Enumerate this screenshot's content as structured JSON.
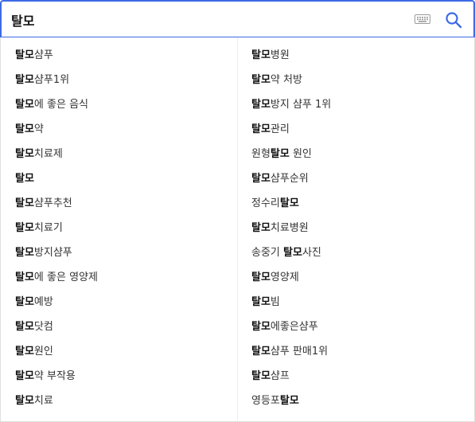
{
  "search": {
    "query": "탈모",
    "keyboard_icon": "keyboard-icon",
    "search_icon": "search-icon",
    "accent_color": "#3d6ae6"
  },
  "suggestions": {
    "left": [
      {
        "pre": "",
        "match": "탈모",
        "post": "샴푸"
      },
      {
        "pre": "",
        "match": "탈모",
        "post": "샴푸1위"
      },
      {
        "pre": "",
        "match": "탈모",
        "post": "에 좋은 음식"
      },
      {
        "pre": "",
        "match": "탈모",
        "post": "약"
      },
      {
        "pre": "",
        "match": "탈모",
        "post": "치료제"
      },
      {
        "pre": "",
        "match": "탈모",
        "post": ""
      },
      {
        "pre": "",
        "match": "탈모",
        "post": "샴푸추천"
      },
      {
        "pre": "",
        "match": "탈모",
        "post": "치료기"
      },
      {
        "pre": "",
        "match": "탈모",
        "post": "방지샴푸"
      },
      {
        "pre": "",
        "match": "탈모",
        "post": "에 좋은 영양제"
      },
      {
        "pre": "",
        "match": "탈모",
        "post": "예방"
      },
      {
        "pre": "",
        "match": "탈모",
        "post": "닷컴"
      },
      {
        "pre": "",
        "match": "탈모",
        "post": "원인"
      },
      {
        "pre": "",
        "match": "탈모",
        "post": "약 부작용"
      },
      {
        "pre": "",
        "match": "탈모",
        "post": "치료"
      }
    ],
    "right": [
      {
        "pre": "",
        "match": "탈모",
        "post": "병원"
      },
      {
        "pre": "",
        "match": "탈모",
        "post": "약 처방"
      },
      {
        "pre": "",
        "match": "탈모",
        "post": "방지 샴푸 1위"
      },
      {
        "pre": "",
        "match": "탈모",
        "post": "관리"
      },
      {
        "pre": "원형",
        "match": "탈모",
        "post": " 원인"
      },
      {
        "pre": "",
        "match": "탈모",
        "post": "샴푸순위"
      },
      {
        "pre": "정수리",
        "match": "탈모",
        "post": ""
      },
      {
        "pre": "",
        "match": "탈모",
        "post": "치료병원"
      },
      {
        "pre": "송중기 ",
        "match": "탈모",
        "post": "사진"
      },
      {
        "pre": "",
        "match": "탈모",
        "post": "영양제"
      },
      {
        "pre": "",
        "match": "탈모",
        "post": "빔"
      },
      {
        "pre": "",
        "match": "탈모",
        "post": "에좋은샴푸"
      },
      {
        "pre": "",
        "match": "탈모",
        "post": "샴푸 판매1위"
      },
      {
        "pre": "",
        "match": "탈모",
        "post": "샴프"
      },
      {
        "pre": "영등포",
        "match": "탈모",
        "post": ""
      }
    ]
  }
}
